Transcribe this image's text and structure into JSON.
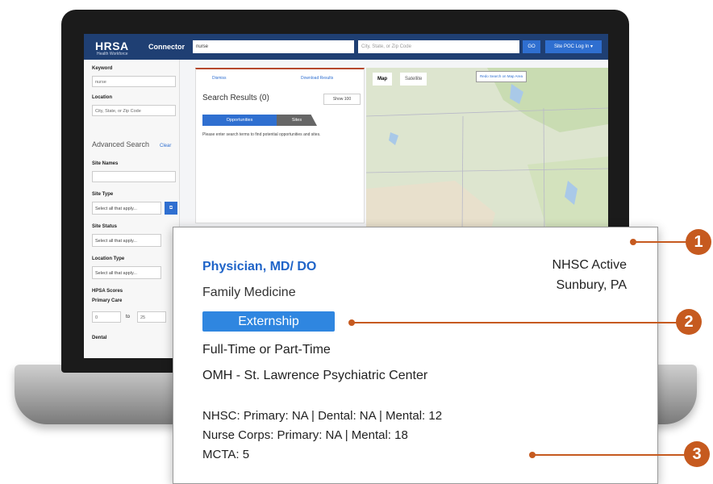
{
  "app": {
    "logo": "HRSA",
    "logo_sub": "Health Workforce",
    "name": "Connector"
  },
  "search": {
    "keyword_value": "nurse",
    "location_placeholder": "City, State, or Zip Code",
    "go_label": "GO",
    "login_label": "Site POC Log In ▾"
  },
  "sidebar": {
    "keyword_label": "Keyword",
    "keyword_value": "nurse",
    "location_label": "Location",
    "location_placeholder": "City, State, or Zip Code",
    "advanced_label": "Advanced Search",
    "clear_label": "Clear",
    "site_names_label": "Site Names",
    "site_type_label": "Site Type",
    "site_type_value": "Select all that apply...",
    "site_status_label": "Site Status",
    "site_status_value": "Select all that apply...",
    "location_type_label": "Location Type",
    "location_type_value": "Select all that apply...",
    "hpsa_label": "HPSA Scores",
    "primary_care_label": "Primary Care",
    "range_min": "0",
    "range_to": "to",
    "range_max": "25",
    "dental_label": "Dental"
  },
  "results": {
    "dismiss_label": "Dismiss",
    "download_label": "Download Results",
    "title": "Search Results (0)",
    "show_label": "Show 100",
    "tab_opportunities": "Opportunities",
    "tab_sites": "Sites",
    "message": "Please enter search terms to find potential opportunities and sites."
  },
  "map": {
    "map_label": "Map",
    "satellite_label": "Satellite",
    "search_button": "Redo Search on Map Area"
  },
  "card": {
    "title": "Physician, MD/ DO",
    "specialty": "Family Medicine",
    "badge": "Externship",
    "schedule": "Full-Time or Part-Time",
    "site": "OMH - St. Lawrence Psychiatric Center",
    "status": "NHSC Active",
    "city": "Sunbury, PA",
    "score_nhsc": "NHSC: Primary: NA | Dental: NA  | Mental:  12",
    "score_nurse": "Nurse Corps: Primary: NA | Mental:  18",
    "score_mcta": "MCTA: 5"
  },
  "callouts": {
    "one": "1",
    "two": "2",
    "three": "3"
  },
  "colors": {
    "brand_navy": "#1f3f73",
    "accent_blue": "#2f6fd0",
    "title_blue": "#1f64c8",
    "badge_blue": "#2f86e0",
    "callout_orange": "#c65a1f"
  }
}
